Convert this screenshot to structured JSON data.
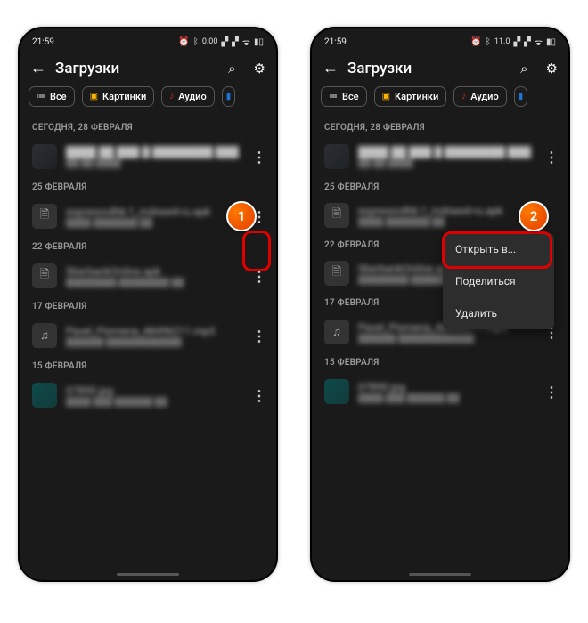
{
  "status": {
    "time": "21:59",
    "icons": [
      "⏰",
      "⋮",
      "ᯤ",
      "KB/S",
      "▁▂",
      "▁▂",
      "▯◧"
    ],
    "speed1": "0.00",
    "speed2": "11.0"
  },
  "appbar": {
    "title": "Загрузки"
  },
  "chips": {
    "all": "Все",
    "pictures": "Картинки",
    "audio": "Аудио"
  },
  "sections": [
    {
      "date": "СЕГОДНЯ, 28 ФЕВРАЛЯ",
      "item": {
        "l1": "████ ██ ███ █ ████████ ████",
        "l2": "██ ██ ████"
      }
    },
    {
      "date": "25 ФЕВРАЛЯ",
      "item": {
        "l1": "expressvdhk-1_mdrawd-ru.apk",
        "l2": "████ ███████ ██"
      }
    },
    {
      "date": "22 ФЕВРАЛЯ",
      "item": {
        "l1": "SberbankOnline.apk",
        "l2": "████████ ████████ ██"
      }
    },
    {
      "date": "17 ФЕВРАЛЯ",
      "item": {
        "l1": "Pavel_Pismena_48496211.mp3",
        "l2": "██████  ████████████"
      }
    },
    {
      "date": "15 ФЕВРАЛЯ",
      "item": {
        "l1": "07890.jpg",
        "l2": "████ ███ ██████ ██"
      }
    }
  ],
  "context_menu": {
    "open_in": "Открыть в...",
    "share": "Поделиться",
    "delete": "Удалить"
  },
  "badges": {
    "b1": "1",
    "b2": "2"
  }
}
